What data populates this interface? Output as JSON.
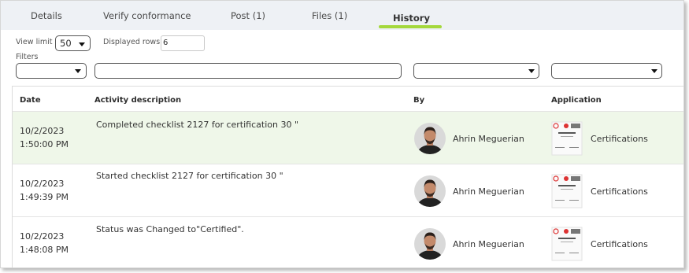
{
  "tabs": [
    {
      "label": "Details",
      "active": false
    },
    {
      "label": "Verify conformance",
      "active": false
    },
    {
      "label": "Post (1)",
      "active": false
    },
    {
      "label": "Files (1)",
      "active": false
    },
    {
      "label": "History",
      "active": true
    }
  ],
  "accent_color": "#a4d83c",
  "controls": {
    "view_limit_label": "View limit",
    "view_limit_value": "50",
    "displayed_rows_label": "Displayed rows",
    "displayed_rows_value": "6",
    "filters_label": "Filters"
  },
  "table": {
    "columns": [
      "Date",
      "Activity description",
      "By",
      "Application"
    ],
    "rows": [
      {
        "date": "10/2/2023",
        "time": "1:50:00 PM",
        "activity": "Completed checklist 2127 for certification 30 \"",
        "by": "Ahrin Meguerian",
        "application": "Certifications",
        "highlighted": true
      },
      {
        "date": "10/2/2023",
        "time": "1:49:39 PM",
        "activity": "Started checklist 2127 for certification 30 \"",
        "by": "Ahrin Meguerian",
        "application": "Certifications",
        "highlighted": false
      },
      {
        "date": "10/2/2023",
        "time": "1:48:08 PM",
        "activity": "Status was Changed to\"Certified\".",
        "by": "Ahrin Meguerian",
        "application": "Certifications",
        "highlighted": false
      }
    ],
    "highlight_color": "#eff7e9"
  },
  "icons": {
    "avatar": "user-avatar-icon",
    "application": "certificate-thumbnail-icon",
    "dropdown": "caret-down-icon"
  }
}
